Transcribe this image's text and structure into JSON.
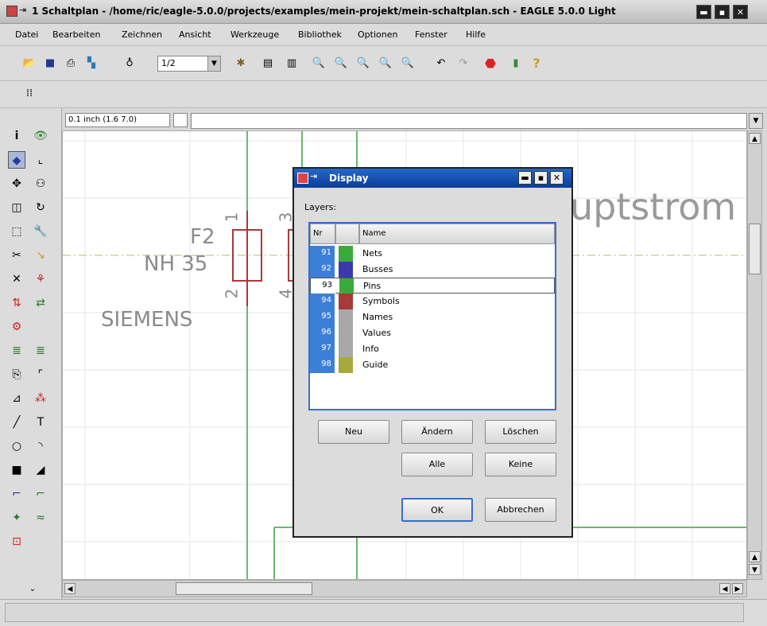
{
  "window": {
    "title": "1 Schaltplan - /home/ric/eagle-5.0.0/projects/examples/mein-projekt/mein-schaltplan.sch - EAGLE 5.0.0 Light"
  },
  "menu": {
    "items": [
      "Datei",
      "Bearbeiten",
      "Zeichnen",
      "Ansicht",
      "Werkzeuge",
      "Bibliothek",
      "Optionen",
      "Fenster",
      "Hilfe"
    ]
  },
  "toolbar": {
    "sheet_value": "1/2"
  },
  "command": {
    "grid_display": "0.1 inch (1.6 7.0)"
  },
  "canvas": {
    "labels": {
      "part_name": "F2",
      "part_value": "NH 35",
      "manufacturer": "SIEMENS",
      "pin1": "1",
      "pin2": "2",
      "pin3": "3",
      "pin4": "4",
      "heading": "uptstrom"
    }
  },
  "dialog": {
    "title": "Display",
    "layers_label": "Layers:",
    "headers": {
      "nr": "Nr",
      "name": "Name"
    },
    "layers": [
      {
        "nr": "91",
        "name": "Nets",
        "color": "#3aaa3a",
        "selected": false
      },
      {
        "nr": "92",
        "name": "Busses",
        "color": "#3a3aaa",
        "selected": false
      },
      {
        "nr": "93",
        "name": "Pins",
        "color": "#3aaa3a",
        "selected": true
      },
      {
        "nr": "94",
        "name": "Symbols",
        "color": "#a83a3a",
        "selected": false
      },
      {
        "nr": "95",
        "name": "Names",
        "color": "#a8a8a8",
        "selected": false
      },
      {
        "nr": "96",
        "name": "Values",
        "color": "#a8a8a8",
        "selected": false
      },
      {
        "nr": "97",
        "name": "Info",
        "color": "#a8a8a8",
        "selected": false
      },
      {
        "nr": "98",
        "name": "Guide",
        "color": "#a8a840",
        "selected": false
      }
    ],
    "buttons": {
      "new": "Neu",
      "change": "Ändern",
      "delete": "Löschen",
      "all": "Alle",
      "none": "Keine",
      "ok": "OK",
      "cancel": "Abbrechen"
    }
  }
}
